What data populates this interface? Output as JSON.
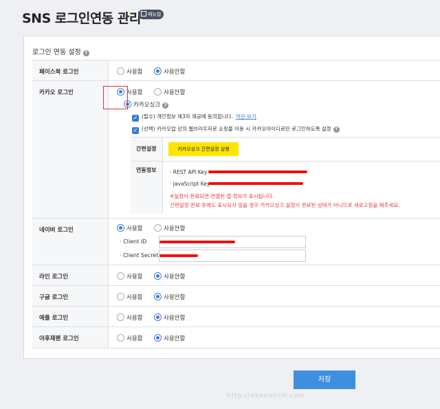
{
  "header": {
    "title": "SNS 로그인연동 관리",
    "manual_badge": "매뉴얼"
  },
  "section": {
    "title": "로그인 연동 설정"
  },
  "facebook": {
    "label": "페이스북 로그인",
    "opt_use": "사용함",
    "opt_nouse": "사용안함"
  },
  "kakao": {
    "label": "카카오 로그인",
    "opt_use": "사용함",
    "opt_nouse": "사용안함",
    "sync_label": "카카오싱크",
    "check1": "(필수) 개인정보 제3자 제공에 동의합니다.",
    "check1_link": "약관 보기",
    "check2": "(선택) 카카오업 상의 웹브라우저로 쇼핑몰 이용 시 카카오아이디로만 로그인하도록 설정",
    "easy_setup_label": "간편설정",
    "easy_setup_button": "카카오싱크 간편설정 실행",
    "link_info_label": "연동정보",
    "rest_key_label": "REST API Key",
    "js_key_label": "JavaScript Key",
    "warn1": "※설정이 완료되면 연결된 앱 정보가 표시됩니다.",
    "warn2": "간편설정 완료 후에도 표시되지 않을 경우 카카오싱크 설정이 완료된 상태가 아니므로 새로고침을 해주세요."
  },
  "naver": {
    "label": "네이버 로그인",
    "opt_use": "사용함",
    "opt_nouse": "사용안함",
    "client_id_label": "Client ID",
    "client_secret_label": "Client Secret"
  },
  "line": {
    "label": "라인 로그인",
    "opt_use": "사용함",
    "opt_nouse": "사용안함"
  },
  "google": {
    "label": "구글 로그인",
    "opt_use": "사용함",
    "opt_nouse": "사용안함"
  },
  "apple": {
    "label": "애플 로그인",
    "opt_use": "사용함",
    "opt_nouse": "사용안함"
  },
  "yahoo": {
    "label": "야후재팬 로그인",
    "opt_use": "사용함",
    "opt_nouse": "사용안함"
  },
  "footer": {
    "save_button": "저장",
    "watermark": "http://ekkeulrim.com"
  },
  "colors": {
    "accent": "#3b7dd8",
    "kakao_yellow": "#fde500",
    "warning": "#e53c3c",
    "save": "#3d8fe0"
  }
}
